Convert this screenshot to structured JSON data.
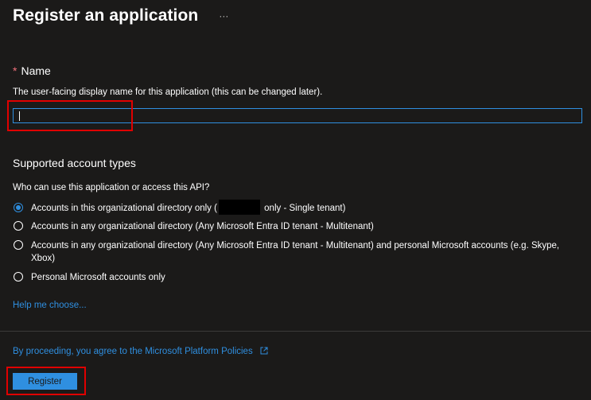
{
  "header": {
    "title": "Register an application",
    "more_label": "···"
  },
  "name_section": {
    "required_marker": "*",
    "heading": "Name",
    "description": "The user-facing display name for this application (this can be changed later).",
    "input_value": "",
    "input_placeholder": ""
  },
  "account_types": {
    "heading": "Supported account types",
    "question": "Who can use this application or access this API?",
    "options": [
      {
        "label_before": "Accounts in this organizational directory only (",
        "label_after": " only - Single tenant)",
        "checked": true
      },
      {
        "label": "Accounts in any organizational directory (Any Microsoft Entra ID tenant - Multitenant)",
        "checked": false
      },
      {
        "label": "Accounts in any organizational directory (Any Microsoft Entra ID tenant - Multitenant) and personal Microsoft accounts (e.g. Skype, Xbox)",
        "checked": false
      },
      {
        "label": "Personal Microsoft accounts only",
        "checked": false
      }
    ],
    "help_link": "Help me choose..."
  },
  "footer": {
    "policy_text": "By proceeding, you agree to the Microsoft Platform Policies",
    "register_label": "Register"
  },
  "icons": {
    "more": "ellipsis-icon",
    "external_link": "external-link-icon"
  },
  "colors": {
    "background": "#1b1a19",
    "accent": "#2f8fe0",
    "required": "#f1707b",
    "highlight": "#e00000",
    "divider": "#3b3a39"
  }
}
